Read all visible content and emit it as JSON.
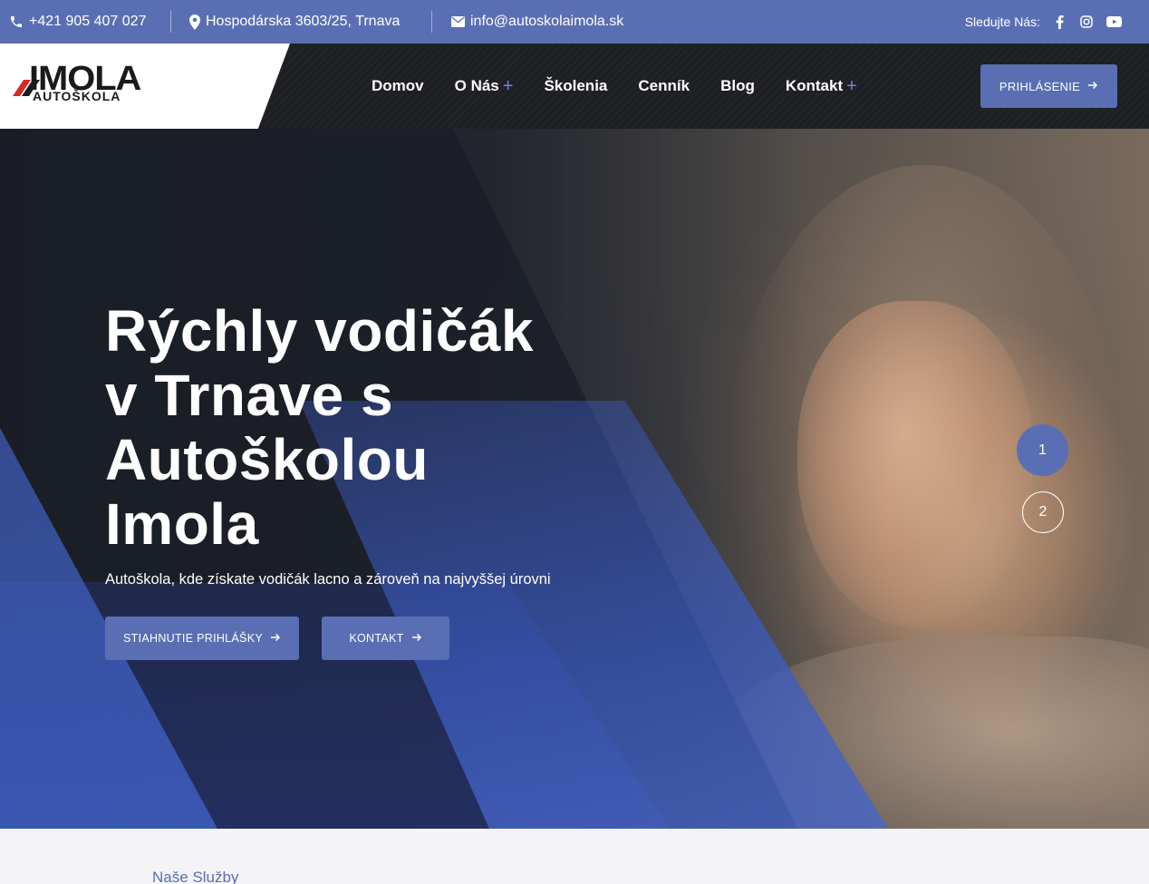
{
  "topbar": {
    "phone": "+421 905 407 027",
    "address": "Hospodárska 3603/25, Trnava",
    "email": "info@autoskolaimola.sk",
    "follow_label": "Sledujte Nás:",
    "social": [
      "facebook-icon",
      "instagram-icon",
      "youtube-icon"
    ]
  },
  "logo": {
    "main": "IMOLA",
    "sub": "AUTOŠKOLA"
  },
  "nav": {
    "items": [
      {
        "label": "Domov",
        "has_submenu": false
      },
      {
        "label": "O Nás",
        "has_submenu": true
      },
      {
        "label": "Školenia",
        "has_submenu": false
      },
      {
        "label": "Cenník",
        "has_submenu": false
      },
      {
        "label": "Blog",
        "has_submenu": false
      },
      {
        "label": "Kontakt",
        "has_submenu": true
      }
    ],
    "plus_symbol": "+",
    "login_label": "PRIHLÁSENIE"
  },
  "hero": {
    "title_lines": [
      "Rýchly vodičák",
      "v Trnave s",
      "Autoškolou",
      "Imola"
    ],
    "subtitle": "Autoškola, kde získate vodičák lacno a zároveň na najvyššej úrovni",
    "btn_download": "STIAHNUTIE PRIHLÁŠKY",
    "btn_contact": "KONTAKT",
    "slides": [
      "1",
      "2"
    ],
    "active_slide": "1"
  },
  "services": {
    "label": "Naše Služby"
  },
  "colors": {
    "accent": "#5a6fb3",
    "nav_bg": "#1e1f23",
    "topbar": "#5a6fb3"
  }
}
